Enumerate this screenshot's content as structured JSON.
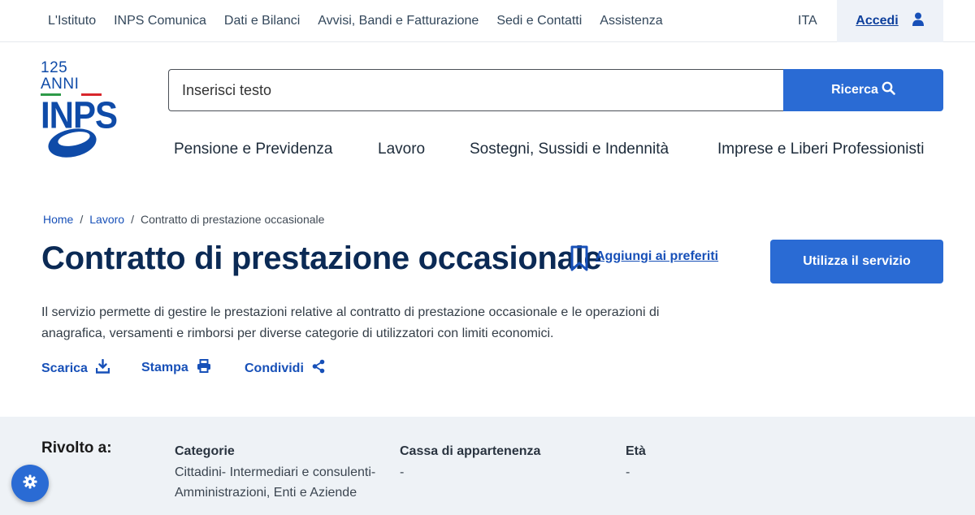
{
  "topnav": {
    "items": [
      "L'Istituto",
      "INPS Comunica",
      "Dati e Bilanci",
      "Avvisi, Bandi e Fatturazione",
      "Sedi e Contatti",
      "Assistenza"
    ],
    "language": "ITA",
    "login_label": "Accedi"
  },
  "logo": {
    "anni": "125 ANNI",
    "name": "INPS"
  },
  "search": {
    "placeholder": "Inserisci testo",
    "button_label": "Ricerca"
  },
  "mainnav": {
    "items": [
      "Pensione e Previdenza",
      "Lavoro",
      "Sostegni, Sussidi e Indennità",
      "Imprese e Liberi Professionisti"
    ]
  },
  "breadcrumb": {
    "items": [
      "Home",
      "Lavoro",
      "Contratto di prestazione occasionale"
    ]
  },
  "page": {
    "title": "Contratto di prestazione occasionale",
    "favorite_label": "Aggiungi ai preferiti",
    "cta_label": "Utilizza il servizio",
    "description": "Il servizio permette di gestire le prestazioni relative al contratto di prestazione occasionale e le operazioni di anagrafica, versamenti e rimborsi per diverse categorie di utilizzatori con limiti economici."
  },
  "actions": {
    "download": "Scarica",
    "print": "Stampa",
    "share": "Condividi"
  },
  "target": {
    "heading": "Rivolto a:",
    "columns": [
      {
        "title": "Categorie",
        "value": "Cittadini- Intermediari e consulenti- Amministrazioni, Enti e Aziende"
      },
      {
        "title": "Cassa di appartenenza",
        "value": "-"
      },
      {
        "title": "Età",
        "value": "-"
      }
    ]
  },
  "colors": {
    "primary": "#2a6bd4",
    "link": "#1750b8",
    "title": "#0b2a55",
    "band": "#eef2f6"
  },
  "icons": [
    "user-icon",
    "search-icon",
    "bookmark-icon",
    "download-icon",
    "print-icon",
    "share-icon",
    "gear-icon"
  ]
}
